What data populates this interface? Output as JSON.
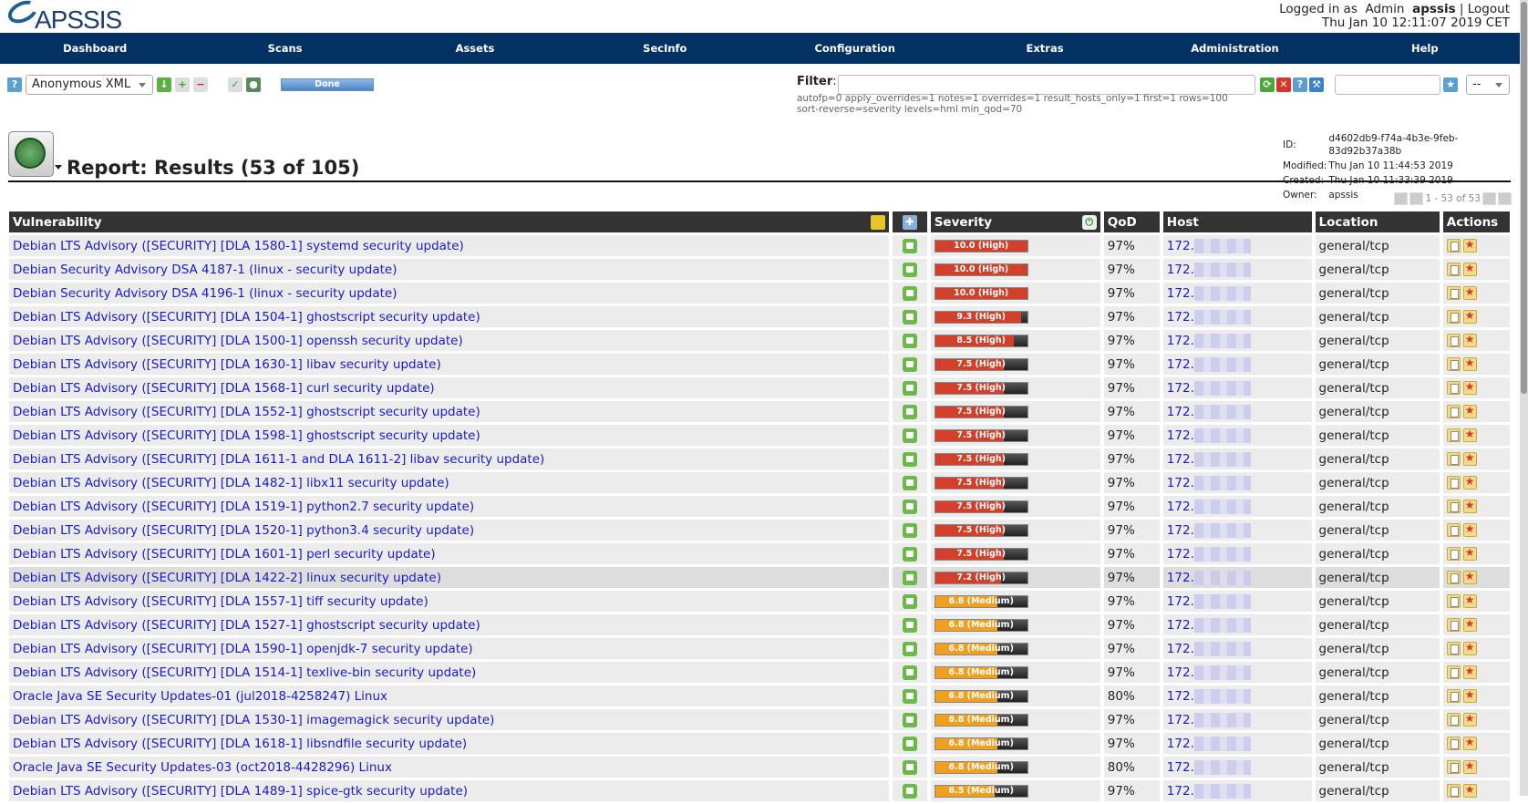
{
  "logo": "APSSIS",
  "user": {
    "prefix": "Logged in as",
    "role": "Admin",
    "name": "apssis",
    "sep": "|",
    "logout": "Logout",
    "datetime": "Thu Jan 10 12:11:07 2019 CET"
  },
  "nav": [
    "Dashboard",
    "Scans",
    "Assets",
    "SecInfo",
    "Configuration",
    "Extras",
    "Administration",
    "Help"
  ],
  "toolbar": {
    "format": "Anonymous XML",
    "status": "Done",
    "status_progress": 100
  },
  "filter": {
    "label": "Filter",
    "colon": ":",
    "value": "",
    "text": "autofp=0 apply_overrides=1 notes=1 overrides=1 result_hosts_only=1 first=1 rows=100 sort-reverse=severity levels=hml min_qod=70",
    "saved_select": "--"
  },
  "report": {
    "title": "Report: Results (53 of 105)",
    "meta": [
      [
        "ID:",
        "d4602db9-f74a-4b3e-9feb-83d92b37a38b"
      ],
      [
        "Modified:",
        "Thu Jan 10 11:44:53 2019"
      ],
      [
        "Created:",
        "Thu Jan 10 11:33:39 2019"
      ],
      [
        "Owner:",
        "apssis"
      ]
    ]
  },
  "pager": "1 - 53 of 53",
  "columns": [
    "Vulnerability",
    "",
    "Severity",
    "QoD",
    "Host",
    "Location",
    "Actions"
  ],
  "colors": {
    "high": "#d0402a",
    "medium": "#f0a020",
    "nav": "#023264"
  },
  "rows": [
    {
      "vuln": "Debian LTS Advisory ([SECURITY] [DLA 1580-1] systemd security update)",
      "severity": 10.0,
      "sev_label": "10.0 (High)",
      "level": "high",
      "qod": "97%",
      "host": "172.",
      "location": "general/tcp"
    },
    {
      "vuln": "Debian Security Advisory DSA 4187-1 (linux - security update)",
      "severity": 10.0,
      "sev_label": "10.0 (High)",
      "level": "high",
      "qod": "97%",
      "host": "172.",
      "location": "general/tcp"
    },
    {
      "vuln": "Debian Security Advisory DSA 4196-1 (linux - security update)",
      "severity": 10.0,
      "sev_label": "10.0 (High)",
      "level": "high",
      "qod": "97%",
      "host": "172.",
      "location": "general/tcp"
    },
    {
      "vuln": "Debian LTS Advisory ([SECURITY] [DLA 1504-1] ghostscript security update)",
      "severity": 9.3,
      "sev_label": "9.3 (High)",
      "level": "high",
      "qod": "97%",
      "host": "172.",
      "location": "general/tcp"
    },
    {
      "vuln": "Debian LTS Advisory ([SECURITY] [DLA 1500-1] openssh security update)",
      "severity": 8.5,
      "sev_label": "8.5 (High)",
      "level": "high",
      "qod": "97%",
      "host": "172.",
      "location": "general/tcp"
    },
    {
      "vuln": "Debian LTS Advisory ([SECURITY] [DLA 1630-1] libav security update)",
      "severity": 7.5,
      "sev_label": "7.5 (High)",
      "level": "high",
      "qod": "97%",
      "host": "172.",
      "location": "general/tcp"
    },
    {
      "vuln": "Debian LTS Advisory ([SECURITY] [DLA 1568-1] curl security update)",
      "severity": 7.5,
      "sev_label": "7.5 (High)",
      "level": "high",
      "qod": "97%",
      "host": "172.",
      "location": "general/tcp"
    },
    {
      "vuln": "Debian LTS Advisory ([SECURITY] [DLA 1552-1] ghostscript security update)",
      "severity": 7.5,
      "sev_label": "7.5 (High)",
      "level": "high",
      "qod": "97%",
      "host": "172.",
      "location": "general/tcp"
    },
    {
      "vuln": "Debian LTS Advisory ([SECURITY] [DLA 1598-1] ghostscript security update)",
      "severity": 7.5,
      "sev_label": "7.5 (High)",
      "level": "high",
      "qod": "97%",
      "host": "172.",
      "location": "general/tcp"
    },
    {
      "vuln": "Debian LTS Advisory ([SECURITY] [DLA 1611-1 and DLA 1611-2] libav security update)",
      "severity": 7.5,
      "sev_label": "7.5 (High)",
      "level": "high",
      "qod": "97%",
      "host": "172.",
      "location": "general/tcp"
    },
    {
      "vuln": "Debian LTS Advisory ([SECURITY] [DLA 1482-1] libx11 security update)",
      "severity": 7.5,
      "sev_label": "7.5 (High)",
      "level": "high",
      "qod": "97%",
      "host": "172.",
      "location": "general/tcp"
    },
    {
      "vuln": "Debian LTS Advisory ([SECURITY] [DLA 1519-1] python2.7 security update)",
      "severity": 7.5,
      "sev_label": "7.5 (High)",
      "level": "high",
      "qod": "97%",
      "host": "172.",
      "location": "general/tcp"
    },
    {
      "vuln": "Debian LTS Advisory ([SECURITY] [DLA 1520-1] python3.4 security update)",
      "severity": 7.5,
      "sev_label": "7.5 (High)",
      "level": "high",
      "qod": "97%",
      "host": "172.",
      "location": "general/tcp"
    },
    {
      "vuln": "Debian LTS Advisory ([SECURITY] [DLA 1601-1] perl security update)",
      "severity": 7.5,
      "sev_label": "7.5 (High)",
      "level": "high",
      "qod": "97%",
      "host": "172.",
      "location": "general/tcp"
    },
    {
      "vuln": "Debian LTS Advisory ([SECURITY] [DLA 1422-2] linux security update)",
      "severity": 7.2,
      "sev_label": "7.2 (High)",
      "level": "high",
      "qod": "97%",
      "host": "172.",
      "location": "general/tcp",
      "hover": true
    },
    {
      "vuln": "Debian LTS Advisory ([SECURITY] [DLA 1557-1] tiff security update)",
      "severity": 6.8,
      "sev_label": "6.8 (Medium)",
      "level": "medium",
      "qod": "97%",
      "host": "172.",
      "location": "general/tcp"
    },
    {
      "vuln": "Debian LTS Advisory ([SECURITY] [DLA 1527-1] ghostscript security update)",
      "severity": 6.8,
      "sev_label": "6.8 (Medium)",
      "level": "medium",
      "qod": "97%",
      "host": "172.",
      "location": "general/tcp"
    },
    {
      "vuln": "Debian LTS Advisory ([SECURITY] [DLA 1590-1] openjdk-7 security update)",
      "severity": 6.8,
      "sev_label": "6.8 (Medium)",
      "level": "medium",
      "qod": "97%",
      "host": "172.",
      "location": "general/tcp"
    },
    {
      "vuln": "Debian LTS Advisory ([SECURITY] [DLA 1514-1] texlive-bin security update)",
      "severity": 6.8,
      "sev_label": "6.8 (Medium)",
      "level": "medium",
      "qod": "97%",
      "host": "172.",
      "location": "general/tcp"
    },
    {
      "vuln": "Oracle Java SE Security Updates-01 (jul2018-4258247) Linux",
      "severity": 6.8,
      "sev_label": "6.8 (Medium)",
      "level": "medium",
      "qod": "80%",
      "host": "172.",
      "location": "general/tcp"
    },
    {
      "vuln": "Debian LTS Advisory ([SECURITY] [DLA 1530-1] imagemagick security update)",
      "severity": 6.8,
      "sev_label": "6.8 (Medium)",
      "level": "medium",
      "qod": "97%",
      "host": "172.",
      "location": "general/tcp"
    },
    {
      "vuln": "Debian LTS Advisory ([SECURITY] [DLA 1618-1] libsndfile security update)",
      "severity": 6.8,
      "sev_label": "6.8 (Medium)",
      "level": "medium",
      "qod": "97%",
      "host": "172.",
      "location": "general/tcp"
    },
    {
      "vuln": "Oracle Java SE Security Updates-03 (oct2018-4428296) Linux",
      "severity": 6.8,
      "sev_label": "6.8 (Medium)",
      "level": "medium",
      "qod": "80%",
      "host": "172.",
      "location": "general/tcp"
    },
    {
      "vuln": "Debian LTS Advisory ([SECURITY] [DLA 1489-1] spice-gtk security update)",
      "severity": 6.5,
      "sev_label": "6.5 (Medium)",
      "level": "medium",
      "qod": "97%",
      "host": "172.",
      "location": "general/tcp"
    }
  ]
}
